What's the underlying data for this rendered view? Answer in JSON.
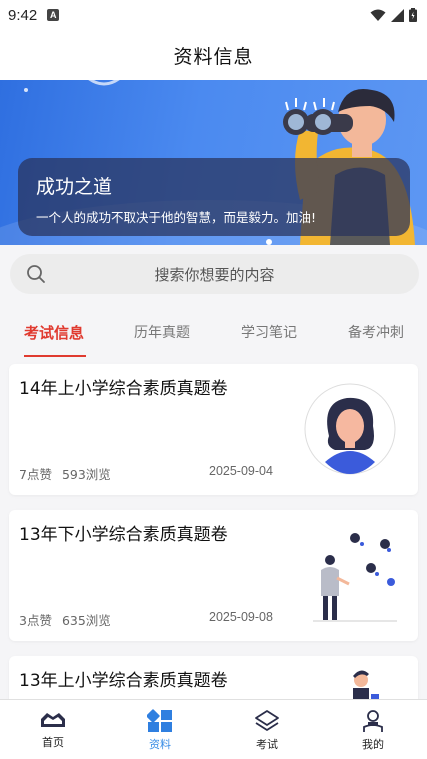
{
  "status_bar": {
    "time": "9:42",
    "notification_letter": "A"
  },
  "header": {
    "title": "资料信息"
  },
  "banner": {
    "title": "成功之道",
    "subtitle": "一个人的成功不取决于他的智慧，而是毅力。加油!"
  },
  "search": {
    "placeholder": "搜索你想要的内容"
  },
  "tabs": [
    {
      "label": "考试信息",
      "active": true
    },
    {
      "label": "历年真题",
      "active": false
    },
    {
      "label": "学习笔记",
      "active": false
    },
    {
      "label": "备考冲刺",
      "active": false
    }
  ],
  "articles": [
    {
      "title": "14年上小学综合素质真题卷",
      "likes": "7点赞",
      "views": "593浏览",
      "date": "2025-09-04"
    },
    {
      "title": "13年下小学综合素质真题卷",
      "likes": "3点赞",
      "views": "635浏览",
      "date": "2025-09-08"
    },
    {
      "title": "13年上小学综合素质真题卷",
      "likes": "",
      "views": "",
      "date": ""
    }
  ],
  "bottom_nav": [
    {
      "label": "首页",
      "icon": "home-icon",
      "active": false
    },
    {
      "label": "资料",
      "icon": "grid-icon",
      "active": true
    },
    {
      "label": "考试",
      "icon": "layers-icon",
      "active": false
    },
    {
      "label": "我的",
      "icon": "user-icon",
      "active": false
    }
  ],
  "colors": {
    "accent_red": "#e03a2f",
    "accent_blue": "#3a8ee6",
    "banner_blue": "#4b8af0"
  }
}
